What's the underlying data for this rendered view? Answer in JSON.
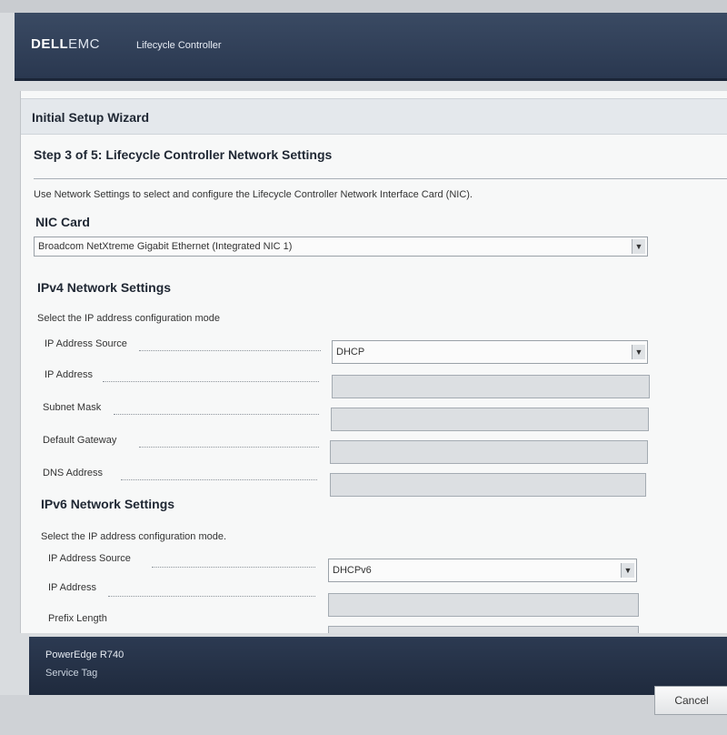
{
  "header": {
    "brand_strong": "DELL",
    "brand_light": "EMC",
    "product": "Lifecycle Controller"
  },
  "wizard": {
    "title": "Initial Setup Wizard",
    "step_title": "Step 3 of 5: Lifecycle Controller Network Settings",
    "intro": "Use Network Settings to select and configure the Lifecycle Controller Network Interface Card (NIC)."
  },
  "nic": {
    "heading": "NIC Card",
    "selected": "Broadcom NetXtreme Gigabit Ethernet (Integrated NIC 1)"
  },
  "ipv4": {
    "heading": "IPv4 Network Settings",
    "note": "Select the IP address configuration mode",
    "source_label": "IP Address Source",
    "source_value": "DHCP",
    "address_label": "IP Address",
    "subnet_label": "Subnet Mask",
    "gateway_label": "Default Gateway",
    "dns_label": "DNS Address"
  },
  "ipv6": {
    "heading": "IPv6 Network Settings",
    "note": "Select the IP address configuration mode.",
    "source_label": "IP Address Source",
    "source_value": "DHCPv6",
    "address_label": "IP Address",
    "prefix_label": "Prefix Length"
  },
  "status": {
    "model": "PowerEdge R740",
    "service_tag": "Service Tag"
  },
  "footer": {
    "cancel": "Cancel"
  },
  "icons": {
    "dropdown": "chevron-down-icon"
  }
}
